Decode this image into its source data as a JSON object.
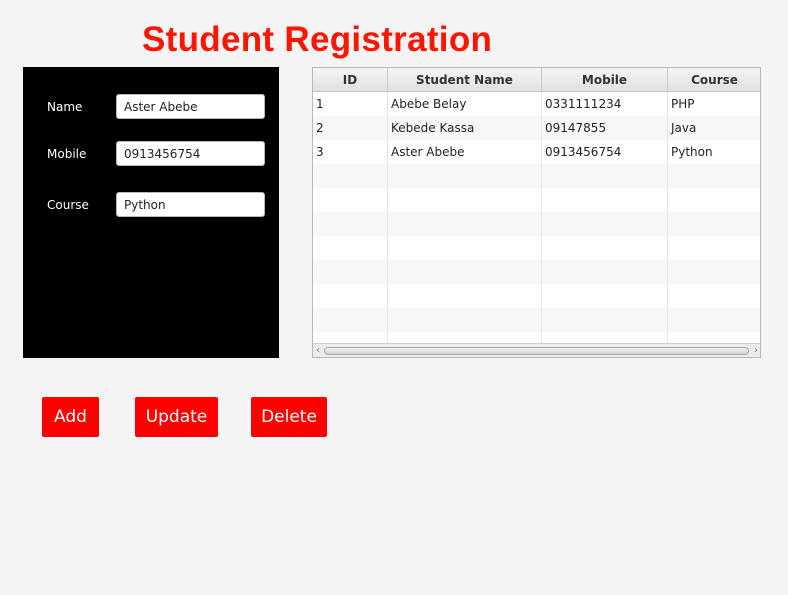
{
  "title": "Student Registration",
  "form": {
    "name_label": "Name",
    "name_value": "Aster Abebe",
    "mobile_label": "Mobile",
    "mobile_value": "0913456754",
    "course_label": "Course",
    "course_value": "Python"
  },
  "table": {
    "columns": [
      "ID",
      "Student Name",
      "Mobile",
      "Course"
    ],
    "rows": [
      [
        "1",
        "Abebe Belay",
        "0331111234",
        "PHP"
      ],
      [
        "2",
        "Kebede Kassa",
        "09147855",
        "Java"
      ],
      [
        "3",
        "Aster Abebe",
        "0913456754",
        "Python"
      ]
    ]
  },
  "buttons": {
    "add": "Add",
    "update": "Update",
    "delete": "Delete"
  },
  "colors": {
    "accent": "#ff0000",
    "title": "#ff1400",
    "panel": "#000000",
    "background": "#f4f4f4"
  },
  "icons": {
    "scroll_left": "chevron-left-icon",
    "scroll_right": "chevron-right-icon"
  }
}
